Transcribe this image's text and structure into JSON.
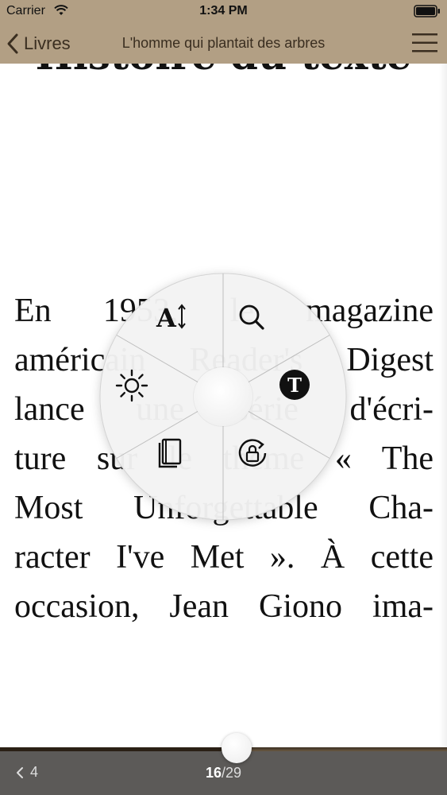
{
  "status_bar": {
    "carrier": "Carrier",
    "time": "1:34 PM"
  },
  "nav": {
    "back_label": "Livres",
    "title": "L'homme qui plantait des arbres"
  },
  "reader": {
    "heading": "Histoire du texte",
    "lines": [
      "En 1953, le magazine",
      "américain Reader's Digest",
      "lance une série d'écri-",
      "ture sur le thème « The",
      "Most Unforgettable Cha-",
      "racter I've Met ». À cette",
      "occasion, Jean Giono ima-"
    ]
  },
  "radial_menu": {
    "items": [
      {
        "id": "font-size",
        "icon": "font-size-icon"
      },
      {
        "id": "search",
        "icon": "search-icon"
      },
      {
        "id": "text-style",
        "icon": "typeface-icon"
      },
      {
        "id": "rotation-lock",
        "icon": "rotation-lock-icon"
      },
      {
        "id": "toc",
        "icon": "book-icon"
      },
      {
        "id": "brightness",
        "icon": "brightness-icon"
      }
    ]
  },
  "footer": {
    "prev_page": "4",
    "current_page": "16",
    "page_separator_total": "/29",
    "progress": 0.53
  },
  "colors": {
    "header": "#b29f84",
    "footer": "#5c5a58",
    "ink": "#111111"
  }
}
